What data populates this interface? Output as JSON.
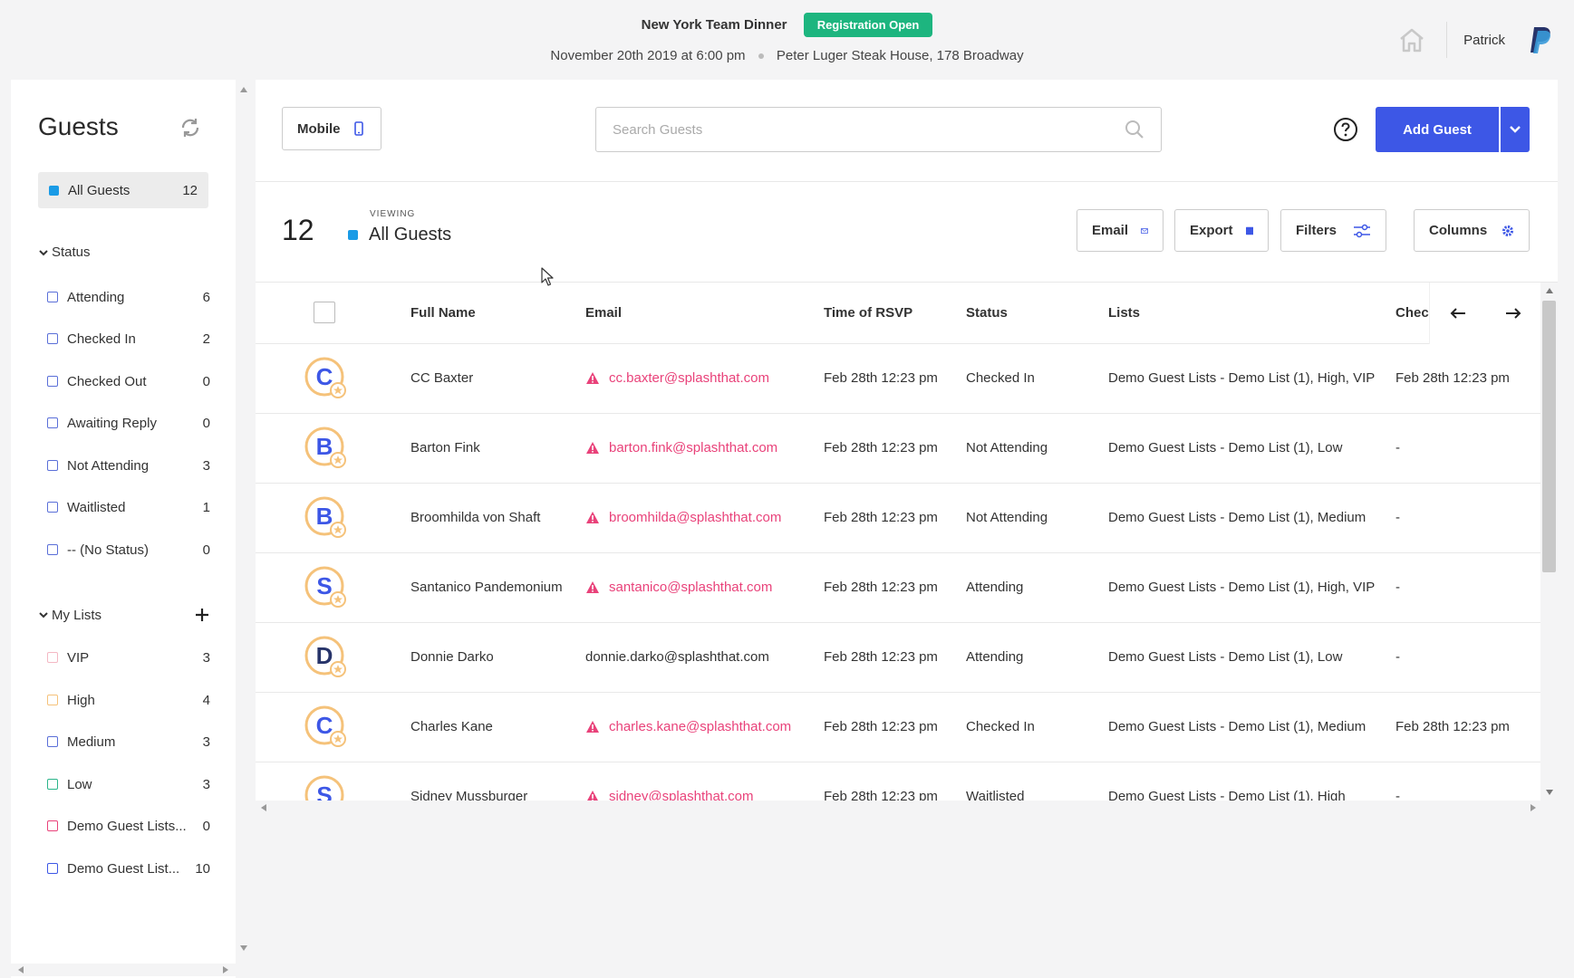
{
  "event": {
    "title": "New York Team Dinner",
    "badge": "Registration Open",
    "date": "November 20th 2019 at 6:00 pm",
    "venue": "Peter Luger Steak House, 178 Broadway"
  },
  "user": {
    "name": "Patrick"
  },
  "colors": {
    "accent": "#3d57e6",
    "badge": "#1db57f",
    "warning": "#e9427a",
    "all_guests": "#1a9be6"
  },
  "sidebar": {
    "title": "Guests",
    "all_guests": {
      "label": "All Guests",
      "count": "12"
    },
    "status_heading": "Status",
    "status_items": [
      {
        "label": "Attending",
        "count": "6"
      },
      {
        "label": "Checked In",
        "count": "2"
      },
      {
        "label": "Checked Out",
        "count": "0"
      },
      {
        "label": "Awaiting Reply",
        "count": "0"
      },
      {
        "label": "Not Attending",
        "count": "3"
      },
      {
        "label": "Waitlisted",
        "count": "1"
      },
      {
        "label": "-- (No Status)",
        "count": "0"
      }
    ],
    "lists_heading": "My Lists",
    "list_items": [
      {
        "label": "VIP",
        "count": "3",
        "color": "#f4b8c4"
      },
      {
        "label": "High",
        "count": "4",
        "color": "#f5c27a"
      },
      {
        "label": "Medium",
        "count": "3",
        "color": "#5a6fd8"
      },
      {
        "label": "Low",
        "count": "3",
        "color": "#2bb58a"
      },
      {
        "label": "Demo Guest Lists...",
        "count": "0",
        "color": "#e9427a"
      },
      {
        "label": "Demo Guest List...",
        "count": "10",
        "color": "#3d57e6"
      }
    ]
  },
  "toolbar": {
    "mobile_label": "Mobile",
    "search_placeholder": "Search Guests",
    "add_guest_label": "Add Guest"
  },
  "summary": {
    "count": "12",
    "viewing_label": "VIEWING",
    "viewing_value": "All Guests"
  },
  "actions": {
    "email": "Email",
    "export": "Export",
    "filters": "Filters",
    "columns": "Columns"
  },
  "table": {
    "columns": [
      "Full Name",
      "Email",
      "Time of RSVP",
      "Status",
      "Lists",
      "Checl"
    ],
    "rows": [
      {
        "name": "CC Baxter",
        "email": "cc.baxter@splashthat.com",
        "warn": true,
        "rsvp": "Feb 28th 12:23 pm",
        "status": "Checked In",
        "lists": "Demo Guest Lists - Demo List (1), High, VIP",
        "checkin": "Feb 28th 12:23 pm",
        "initial": "C"
      },
      {
        "name": "Barton Fink",
        "email": "barton.fink@splashthat.com",
        "warn": true,
        "rsvp": "Feb 28th 12:23 pm",
        "status": "Not Attending",
        "lists": "Demo Guest Lists - Demo List (1), Low",
        "checkin": "-",
        "initial": "B"
      },
      {
        "name": "Broomhilda von Shaft",
        "email": "broomhilda@splashthat.com",
        "warn": true,
        "rsvp": "Feb 28th 12:23 pm",
        "status": "Not Attending",
        "lists": "Demo Guest Lists - Demo List (1), Medium",
        "checkin": "-",
        "initial": "B"
      },
      {
        "name": "Santanico Pandemonium",
        "email": "santanico@splashthat.com",
        "warn": true,
        "rsvp": "Feb 28th 12:23 pm",
        "status": "Attending",
        "lists": "Demo Guest Lists - Demo List (1), High, VIP",
        "checkin": "-",
        "initial": "S"
      },
      {
        "name": "Donnie Darko",
        "email": "donnie.darko@splashthat.com",
        "warn": false,
        "rsvp": "Feb 28th 12:23 pm",
        "status": "Attending",
        "lists": "Demo Guest Lists - Demo List (1), Low",
        "checkin": "-",
        "initial": "D"
      },
      {
        "name": "Charles Kane",
        "email": "charles.kane@splashthat.com",
        "warn": true,
        "rsvp": "Feb 28th 12:23 pm",
        "status": "Checked In",
        "lists": "Demo Guest Lists - Demo List (1), Medium",
        "checkin": "Feb 28th 12:23 pm",
        "initial": "C"
      },
      {
        "name": "Sidney Mussburger",
        "email": "sidney@splashthat.com",
        "warn": true,
        "rsvp": "Feb 28th 12:23 pm",
        "status": "Waitlisted",
        "lists": "Demo Guest Lists - Demo List (1), High",
        "checkin": "-",
        "initial": "S"
      }
    ]
  }
}
